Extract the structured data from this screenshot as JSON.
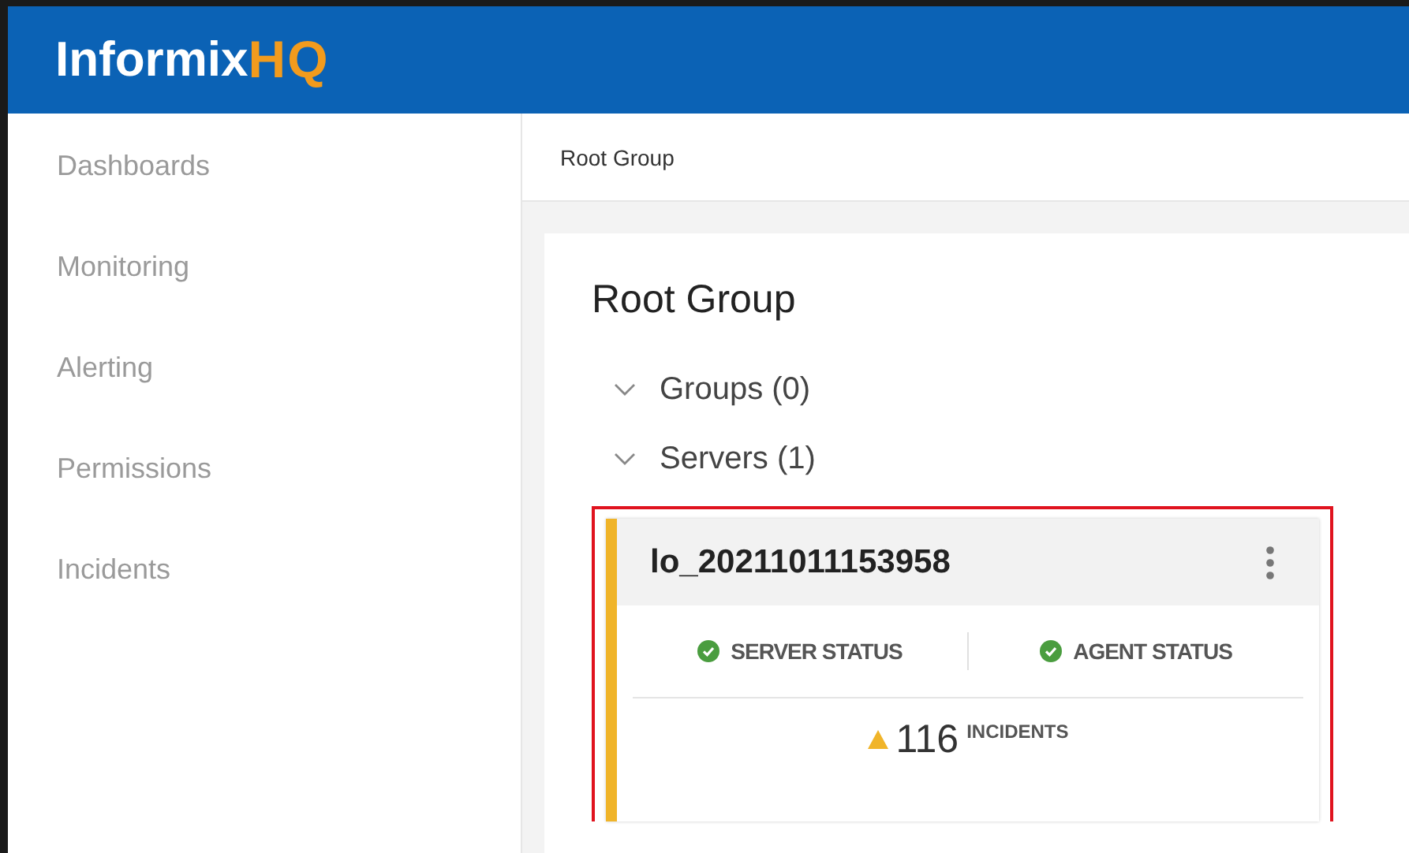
{
  "header": {
    "logo": "Informix",
    "logo_accent": "HQ"
  },
  "sidebar": {
    "items": [
      {
        "label": "Dashboards",
        "selected": false
      },
      {
        "label": "Monitoring",
        "selected": false
      },
      {
        "label": "Alerting",
        "selected": false
      },
      {
        "label": "Permissions",
        "selected": false
      },
      {
        "label": "Incidents",
        "selected": false
      }
    ]
  },
  "breadcrumb": "Root Group",
  "group": {
    "title": "Root Group",
    "sections": [
      {
        "label": "Groups (0)",
        "expanded": true
      },
      {
        "label": "Servers (1)",
        "expanded": true
      }
    ]
  },
  "server_card": {
    "name": "lo_20211011153958",
    "highlighted": true,
    "statuses": [
      {
        "label": "SERVER STATUS",
        "color": "#4a9d3f"
      },
      {
        "label": "AGENT STATUS",
        "color": "#4a9d3f"
      }
    ],
    "incident_count": "116",
    "incident_label": "INCIDENTS"
  }
}
